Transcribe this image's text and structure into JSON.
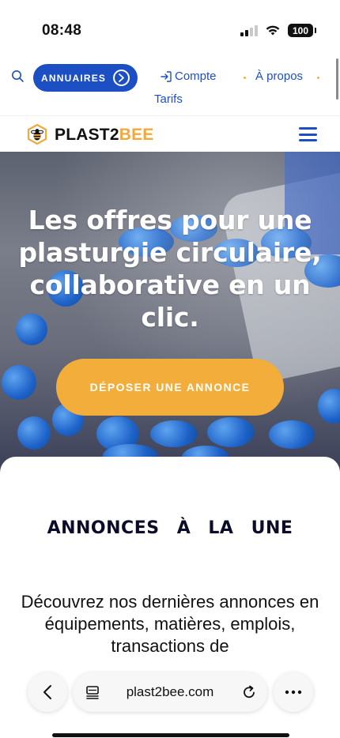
{
  "status": {
    "time": "08:48",
    "battery": "100"
  },
  "nav": {
    "annuaires_label": "ANNUAIRES",
    "compte_label": "Compte",
    "apropos_label": "À propos",
    "tarifs_label": "Tarifs"
  },
  "brand": {
    "name_dark": "PLAST2",
    "name_accent": "BEE",
    "accent_color": "#f0a93a",
    "primary_color": "#1d4fc4"
  },
  "hero": {
    "title": "Les offres pour une plasturgie circulaire, collaborative en un clic.",
    "cta_label": "DÉPOSER UNE ANNONCE",
    "cta_color": "#f2ad3a"
  },
  "section": {
    "title": "ANNONCES À LA UNE",
    "description": "Découvrez nos dernières annonces en équipements, matières, emplois, transactions de"
  },
  "browser": {
    "url": "plast2bee.com"
  },
  "icons": [
    "search-icon",
    "chevron-right-circle-icon",
    "login-icon",
    "bee-logo-icon",
    "hamburger-menu-icon",
    "back-icon",
    "tabs-icon",
    "reload-icon",
    "more-icon"
  ]
}
